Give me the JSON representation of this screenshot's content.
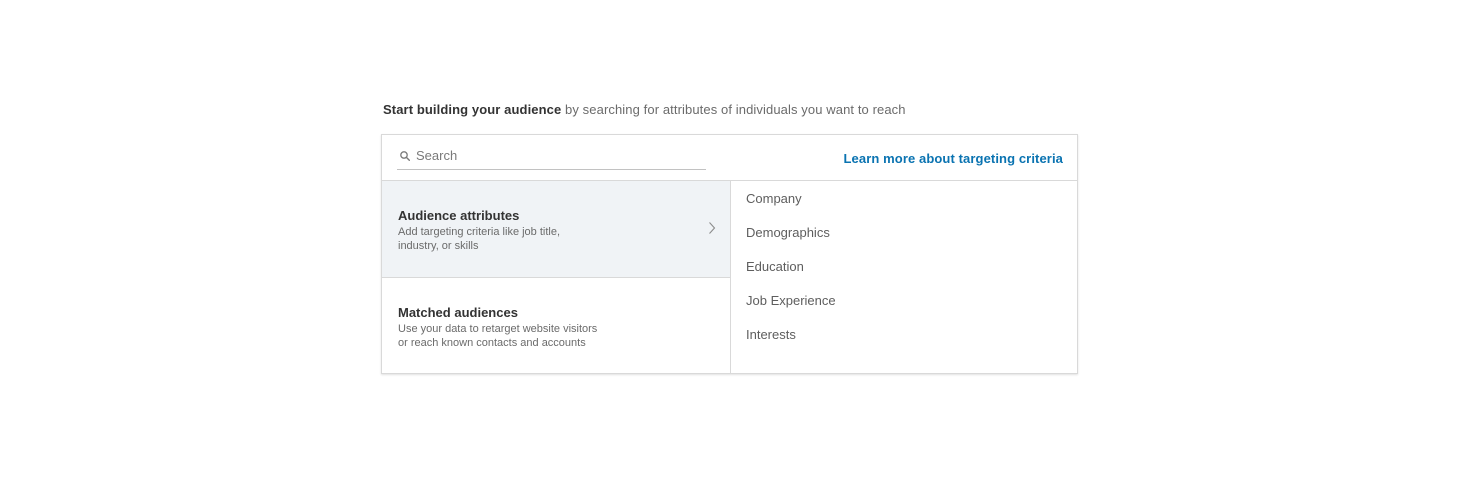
{
  "intro": {
    "bold": "Start building your audience",
    "rest": " by searching for attributes of individuals you want to reach"
  },
  "search": {
    "placeholder": "Search",
    "value": ""
  },
  "learn_more": "Learn more about targeting criteria",
  "categories": [
    {
      "title": "Audience attributes",
      "desc_line1": "Add targeting criteria like job title,",
      "desc_line2": "industry, or skills",
      "selected": true
    },
    {
      "title": "Matched audiences",
      "desc_line1": "Use your data to retarget website visitors",
      "desc_line2": "or reach known contacts and accounts",
      "selected": false
    }
  ],
  "subcategories": [
    "Company",
    "Demographics",
    "Education",
    "Job Experience",
    "Interests"
  ],
  "colors": {
    "link": "#0a73b1",
    "selected_bg": "#f0f3f6",
    "border": "#d9d9d9"
  },
  "icons": {
    "search": "search-icon",
    "chevron": "chevron-right-icon"
  }
}
